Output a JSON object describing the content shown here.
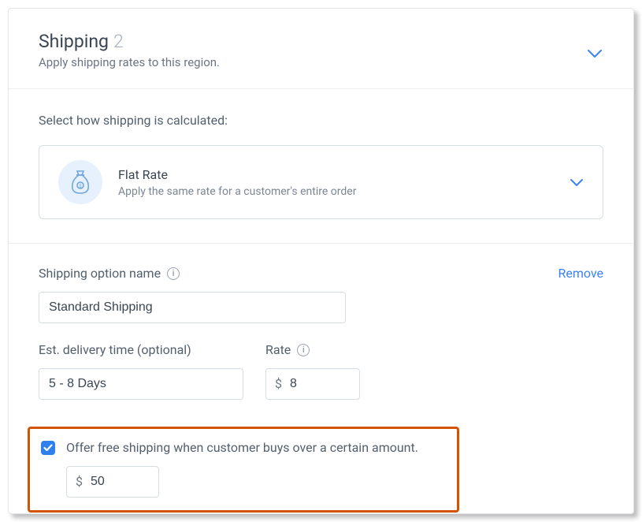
{
  "header": {
    "title": "Shipping",
    "step": "2",
    "subtitle": "Apply shipping rates to this region."
  },
  "calc": {
    "prompt": "Select how shipping is calculated:",
    "option_title": "Flat Rate",
    "option_desc": "Apply the same rate for a customer's entire order"
  },
  "form": {
    "name_label": "Shipping option name",
    "remove": "Remove",
    "name_value": "Standard Shipping",
    "delivery_label": "Est. delivery time (optional)",
    "delivery_value": "5 - 8 Days",
    "rate_label": "Rate",
    "currency": "$",
    "rate_value": "8"
  },
  "free": {
    "checkbox_checked": true,
    "label": "Offer free shipping when customer buys over a certain amount.",
    "currency": "$",
    "threshold": "50"
  }
}
